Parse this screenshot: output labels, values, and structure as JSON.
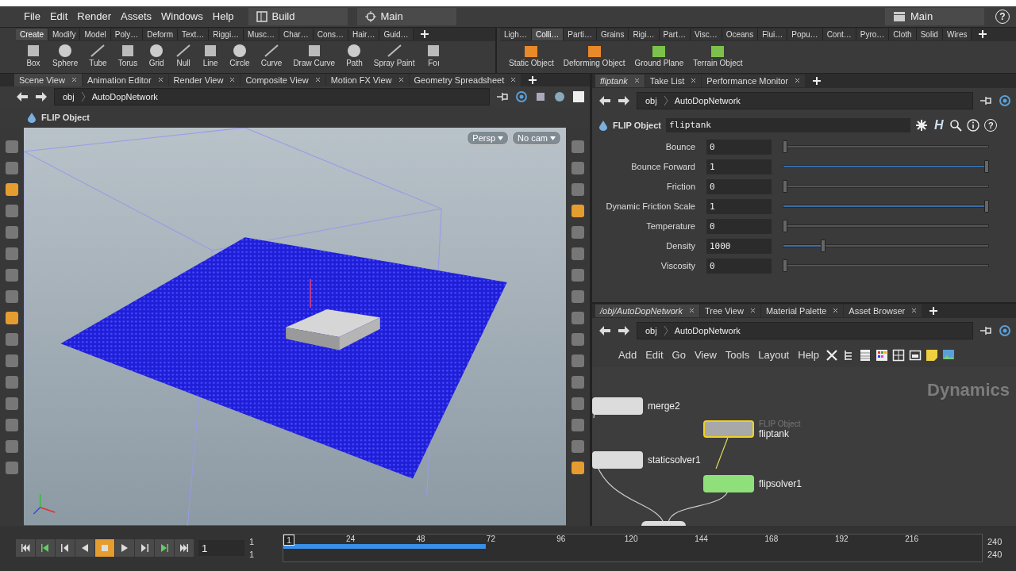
{
  "menu": [
    "File",
    "Edit",
    "Render",
    "Assets",
    "Windows",
    "Help"
  ],
  "desktop": "Build",
  "context": "Main",
  "scene_context": "Main",
  "help_glyph": "?",
  "shelf_left": {
    "tabs": [
      {
        "label": "Create",
        "selected": true
      },
      {
        "label": "Modify",
        "selected": false
      },
      {
        "label": "Model",
        "selected": false
      },
      {
        "label": "Poly…",
        "selected": false
      },
      {
        "label": "Deform",
        "selected": false
      },
      {
        "label": "Text…",
        "selected": false
      },
      {
        "label": "Riggi…",
        "selected": false
      },
      {
        "label": "Musc…",
        "selected": false
      },
      {
        "label": "Char…",
        "selected": false
      },
      {
        "label": "Cons…",
        "selected": false
      },
      {
        "label": "Hair…",
        "selected": false
      },
      {
        "label": "Guid…",
        "selected": false
      }
    ],
    "tools": [
      "Box",
      "Sphere",
      "Tube",
      "Torus",
      "Grid",
      "Null",
      "Line",
      "Circle",
      "Curve",
      "Draw Curve",
      "Path",
      "Spray Paint",
      "Foı"
    ]
  },
  "shelf_right": {
    "tabs": [
      {
        "label": "Ligh…",
        "selected": false
      },
      {
        "label": "Colli…",
        "selected": true
      },
      {
        "label": "Parti…",
        "selected": false
      },
      {
        "label": "Grains",
        "selected": false
      },
      {
        "label": "Rigi…",
        "selected": false
      },
      {
        "label": "Part…",
        "selected": false
      },
      {
        "label": "Visc…",
        "selected": false
      },
      {
        "label": "Oceans",
        "selected": false
      },
      {
        "label": "Flui…",
        "selected": false
      },
      {
        "label": "Popu…",
        "selected": false
      },
      {
        "label": "Cont…",
        "selected": false
      },
      {
        "label": "Pyro…",
        "selected": false
      },
      {
        "label": "Cloth",
        "selected": false
      },
      {
        "label": "Solid",
        "selected": false
      },
      {
        "label": "Wires",
        "selected": false
      }
    ],
    "tools": [
      "Static Object",
      "Deforming Object",
      "Ground Plane",
      "Terrain Object"
    ]
  },
  "viewer": {
    "tabs": [
      {
        "label": "Scene View",
        "selected": true
      },
      {
        "label": "Animation Editor",
        "selected": false
      },
      {
        "label": "Render View",
        "selected": false
      },
      {
        "label": "Composite View",
        "selected": false
      },
      {
        "label": "Motion FX View",
        "selected": false
      },
      {
        "label": "Geometry Spreadsheet",
        "selected": false
      }
    ],
    "path": [
      "obj",
      "AutoDopNetwork"
    ],
    "node_type": "FLIP Object",
    "view_buttons": [
      "Persp",
      "No cam"
    ],
    "left_tools": [
      {
        "selected": false
      },
      {
        "selected": false
      },
      {
        "selected": true
      },
      {
        "selected": false
      },
      {
        "selected": false
      },
      {
        "selected": false
      },
      {
        "selected": false
      },
      {
        "selected": false
      },
      {
        "selected": true
      },
      {
        "selected": false
      },
      {
        "selected": false
      },
      {
        "selected": false
      },
      {
        "selected": false
      },
      {
        "selected": false
      },
      {
        "selected": false
      },
      {
        "selected": false
      }
    ],
    "right_tools": [
      {
        "selected": false
      },
      {
        "selected": false
      },
      {
        "selected": false
      },
      {
        "selected": true
      },
      {
        "selected": false
      },
      {
        "selected": false
      },
      {
        "selected": false
      },
      {
        "selected": false
      },
      {
        "selected": false
      },
      {
        "selected": false
      },
      {
        "selected": false
      },
      {
        "selected": false
      },
      {
        "selected": false
      },
      {
        "selected": false
      },
      {
        "selected": false
      },
      {
        "selected": true
      }
    ]
  },
  "params": {
    "tabs": [
      {
        "label": "fliptank",
        "selected": true
      },
      {
        "label": "Take List",
        "selected": false
      },
      {
        "label": "Performance Monitor",
        "selected": false
      }
    ],
    "path": [
      "obj",
      "AutoDopNetwork"
    ],
    "node_type": "FLIP Object",
    "node_name": "fliptank",
    "h_glyph": "H",
    "help_glyph": "?",
    "rows": [
      {
        "label": "Bounce",
        "value": "0",
        "level": 0
      },
      {
        "label": "Bounce Forward",
        "value": "1",
        "level": 1
      },
      {
        "label": "Friction",
        "value": "0",
        "level": 0
      },
      {
        "label": "Dynamic Friction Scale",
        "value": "1",
        "level": 1
      },
      {
        "label": "Temperature",
        "value": "0",
        "level": 0
      },
      {
        "label": "Density",
        "value": "1000",
        "level": 0.19
      },
      {
        "label": "Viscosity",
        "value": "0",
        "level": 0
      }
    ]
  },
  "network": {
    "tabs": [
      {
        "label": "/obj/AutoDopNetwork",
        "selected": true
      },
      {
        "label": "Tree View",
        "selected": false
      },
      {
        "label": "Material Palette",
        "selected": false
      },
      {
        "label": "Asset Browser",
        "selected": false
      }
    ],
    "path": [
      "obj",
      "AutoDopNetwork"
    ],
    "menu": [
      "Add",
      "Edit",
      "Go",
      "View",
      "Tools",
      "Layout",
      "Help"
    ],
    "context_label": "Dynamics",
    "nodes": [
      {
        "name": "merge2",
        "kind": "merge",
        "selected": false
      },
      {
        "name": "staticsolver1",
        "kind": "solver",
        "selected": false
      },
      {
        "name": "fliptank",
        "type_label": "FLIP Object",
        "kind": "object",
        "selected": true
      },
      {
        "name": "flipsolver1",
        "kind": "flipsolver",
        "selected": false
      }
    ]
  },
  "timeline": {
    "current_frame": "1",
    "start": "1",
    "range_start": "1",
    "end": "240",
    "range_end": "240",
    "marker": "1",
    "ticks": [
      "24",
      "48",
      "72",
      "96",
      "120",
      "144",
      "168",
      "192",
      "216"
    ],
    "cache": {
      "level": 0.29
    },
    "playing": true
  }
}
